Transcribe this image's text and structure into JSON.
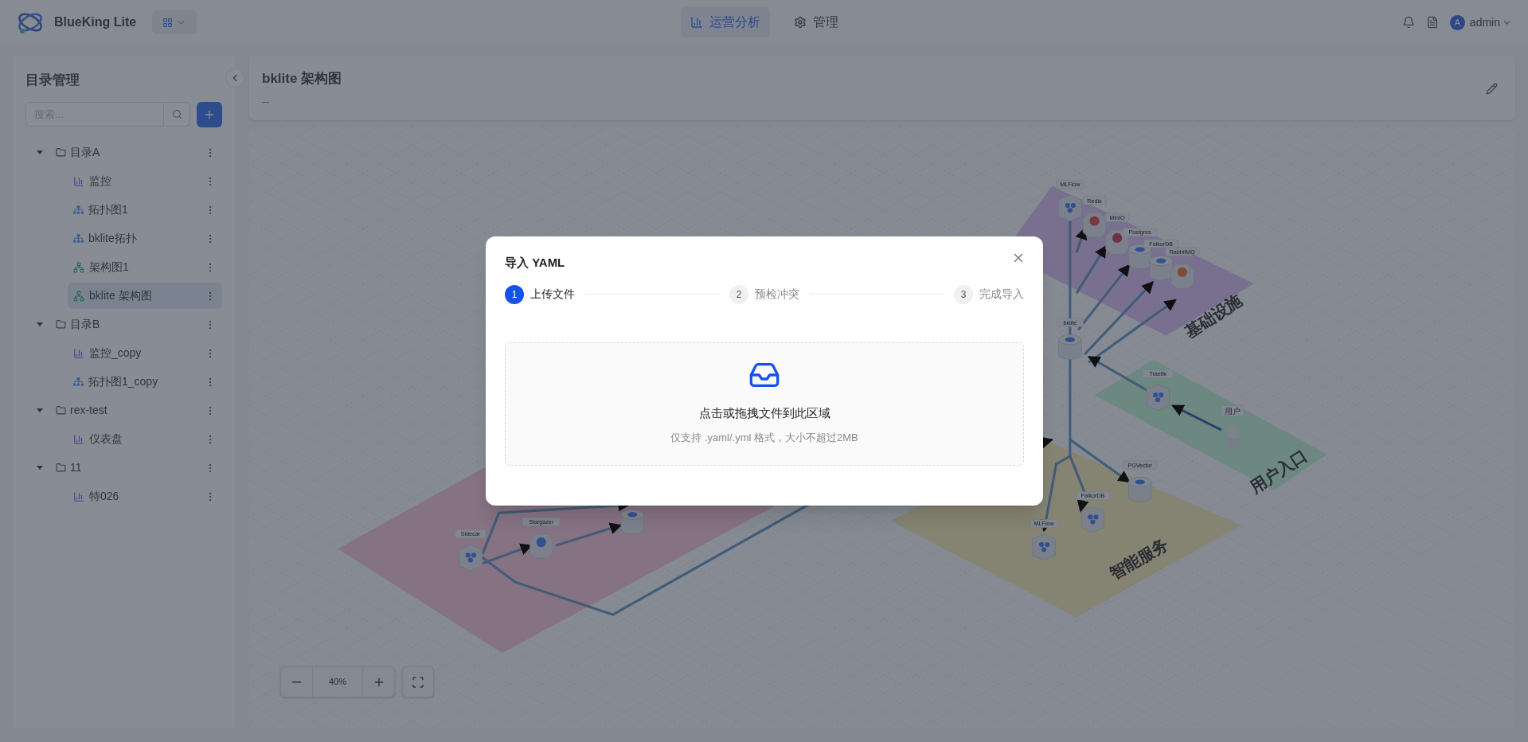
{
  "header": {
    "brand": "BlueKing Lite",
    "nav_tabs": [
      {
        "label": "运营分析",
        "kind": "chart",
        "selected": true
      },
      {
        "label": "管理",
        "kind": "gear",
        "selected": false
      }
    ],
    "user": {
      "initial": "A",
      "name": "admin"
    }
  },
  "sidebar": {
    "title": "目录管理",
    "search": {
      "placeholder": "搜索..."
    },
    "tree": [
      {
        "label": "目录A",
        "kind": "folder",
        "expanded": true,
        "children": [
          {
            "label": "监控",
            "kind": "chart",
            "selected": false
          },
          {
            "label": "拓扑图1",
            "kind": "topology",
            "selected": false
          },
          {
            "label": "bklite拓扑",
            "kind": "topology",
            "selected": false
          },
          {
            "label": "架构图1",
            "kind": "architecture",
            "selected": false
          },
          {
            "label": "bklite 架构图",
            "kind": "architecture",
            "selected": true
          }
        ]
      },
      {
        "label": "目录B",
        "kind": "folder",
        "expanded": true,
        "children": [
          {
            "label": "监控_copy",
            "kind": "chart",
            "selected": false
          },
          {
            "label": "拓扑图1_copy",
            "kind": "topology",
            "selected": false
          }
        ]
      },
      {
        "label": "rex-test",
        "kind": "folder",
        "expanded": true,
        "children": [
          {
            "label": "仪表盘",
            "kind": "chart",
            "selected": false
          }
        ]
      },
      {
        "label": "11",
        "kind": "folder",
        "expanded": true,
        "children": [
          {
            "label": "特026",
            "kind": "chart",
            "selected": false
          }
        ]
      }
    ]
  },
  "view": {
    "title": "bklite 架构图",
    "description": "--"
  },
  "canvas": {
    "zones": [
      {
        "label": "基础设施",
        "color": "#797090"
      },
      {
        "label": "用户入口",
        "color": "#6d8880"
      },
      {
        "label": "智能服务",
        "color": "#858473"
      },
      {
        "color": "#857283"
      }
    ],
    "nodes": [
      {
        "label": "MLFlow",
        "kind": "cube"
      },
      {
        "label": "Redis",
        "kind": "hexagon"
      },
      {
        "label": "MinIO",
        "kind": "hexagon"
      },
      {
        "label": "Postgres",
        "kind": "cylinder"
      },
      {
        "label": "FalkorDB",
        "kind": "cylinder"
      },
      {
        "label": "RabbitMQ",
        "kind": "hexagon"
      },
      {
        "label": "bklite",
        "kind": "cylinder"
      },
      {
        "label": "Traefik",
        "kind": "cube"
      },
      {
        "label": "用户",
        "kind": "person"
      },
      {
        "label": "PGVector",
        "kind": "cylinder"
      },
      {
        "label": "FalkorDB",
        "kind": "cube"
      },
      {
        "label": "MLFlow",
        "kind": "cube"
      },
      {
        "label": "Sidecar",
        "kind": "cube"
      },
      {
        "label": "Stargazer",
        "kind": "hexagon"
      },
      {
        "kind": "cylinder"
      }
    ],
    "zoom": "40%"
  },
  "modal": {
    "title": "导入 YAML",
    "steps": [
      {
        "number": "1",
        "label": "上传文件",
        "selected": true
      },
      {
        "number": "2",
        "label": "预检冲突",
        "selected": false
      },
      {
        "number": "3",
        "label": "完成导入",
        "selected": false
      }
    ],
    "upload": {
      "text": "点击或拖拽文件到此区域",
      "hint": "仅支持 .yaml/.yml 格式，大小不超过2MB"
    }
  }
}
